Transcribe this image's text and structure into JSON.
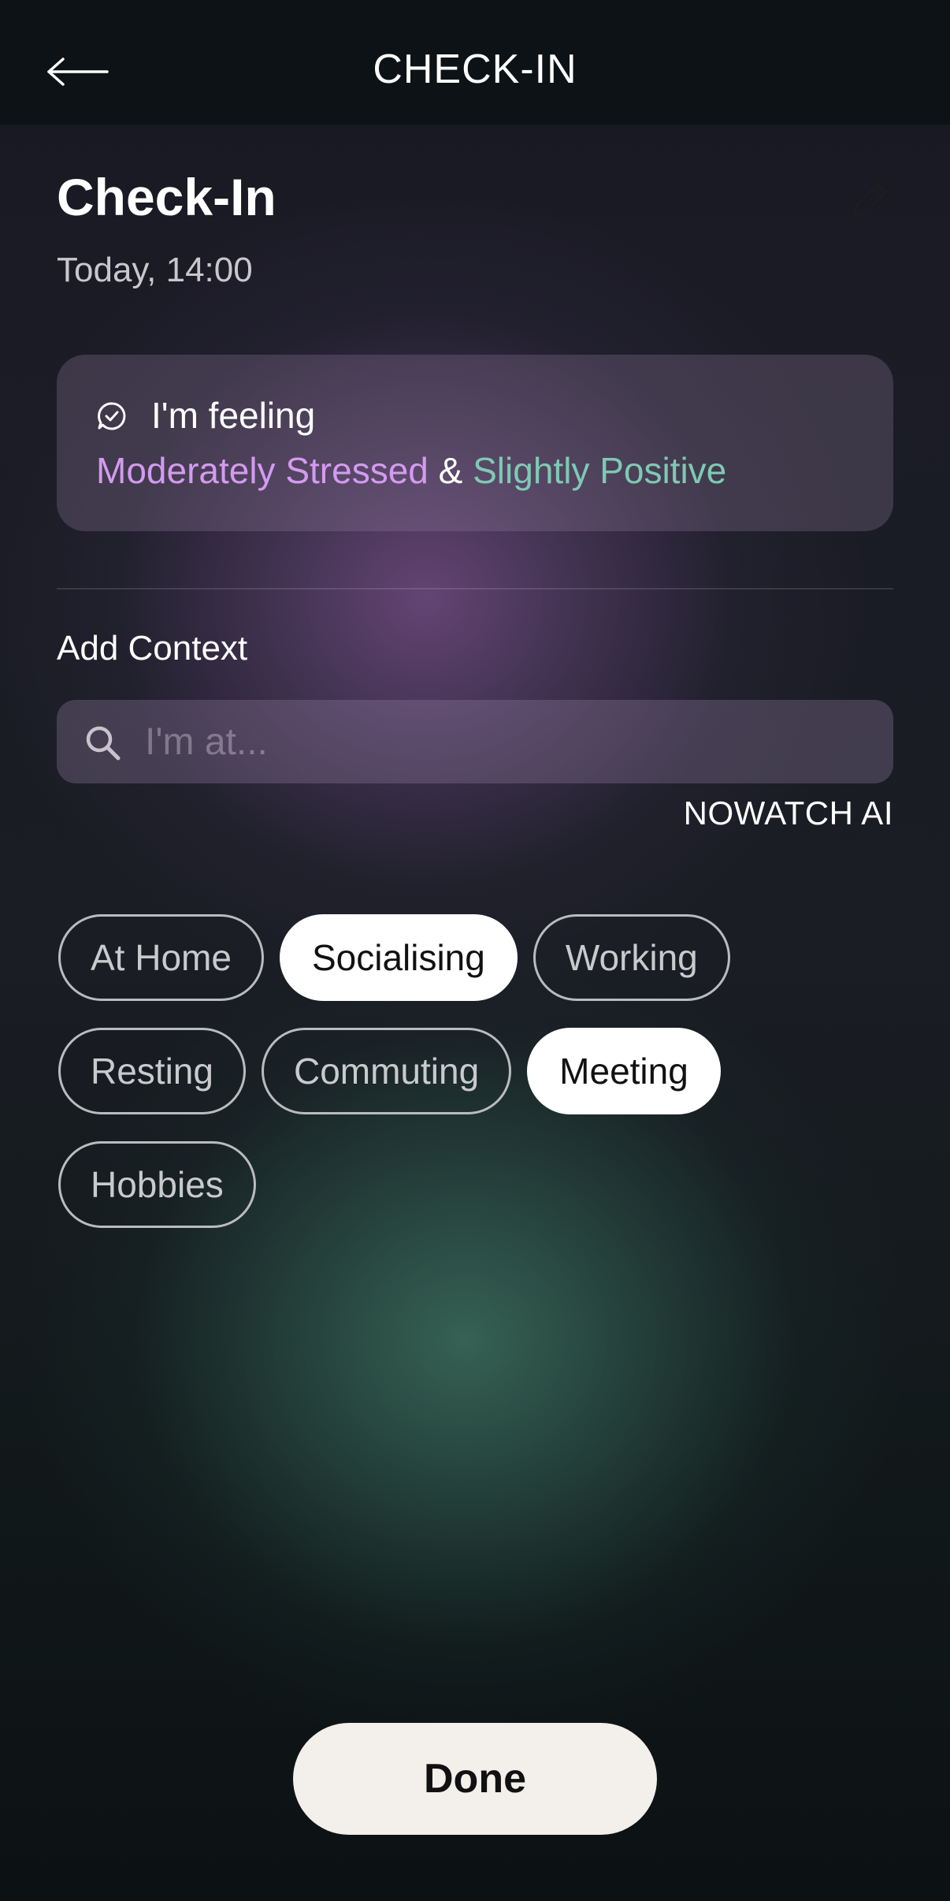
{
  "header": {
    "title": "CHECK-IN",
    "back_icon": "arrow-left-icon"
  },
  "page": {
    "title": "Check-In",
    "timestamp": "Today, 14:00",
    "edit_icon": "pencil-icon"
  },
  "feeling": {
    "icon": "chat-check-icon",
    "label": "I'm feeling",
    "stress": "Moderately Stressed",
    "connector": "&",
    "positivity": "Slightly Positive",
    "colors": {
      "stress": "#d49af0",
      "positivity": "#7fc9b3"
    }
  },
  "context": {
    "title": "Add Context",
    "search_placeholder": "I'm at...",
    "search_value": "",
    "search_icon": "search-icon",
    "ai_label": "NOWATCH AI"
  },
  "chips": [
    {
      "label": "At Home",
      "selected": false
    },
    {
      "label": "Socialising",
      "selected": true
    },
    {
      "label": "Working",
      "selected": false
    },
    {
      "label": "Resting",
      "selected": false
    },
    {
      "label": "Commuting",
      "selected": false
    },
    {
      "label": "Meeting",
      "selected": true
    },
    {
      "label": "Hobbies",
      "selected": false
    }
  ],
  "done_label": "Done"
}
